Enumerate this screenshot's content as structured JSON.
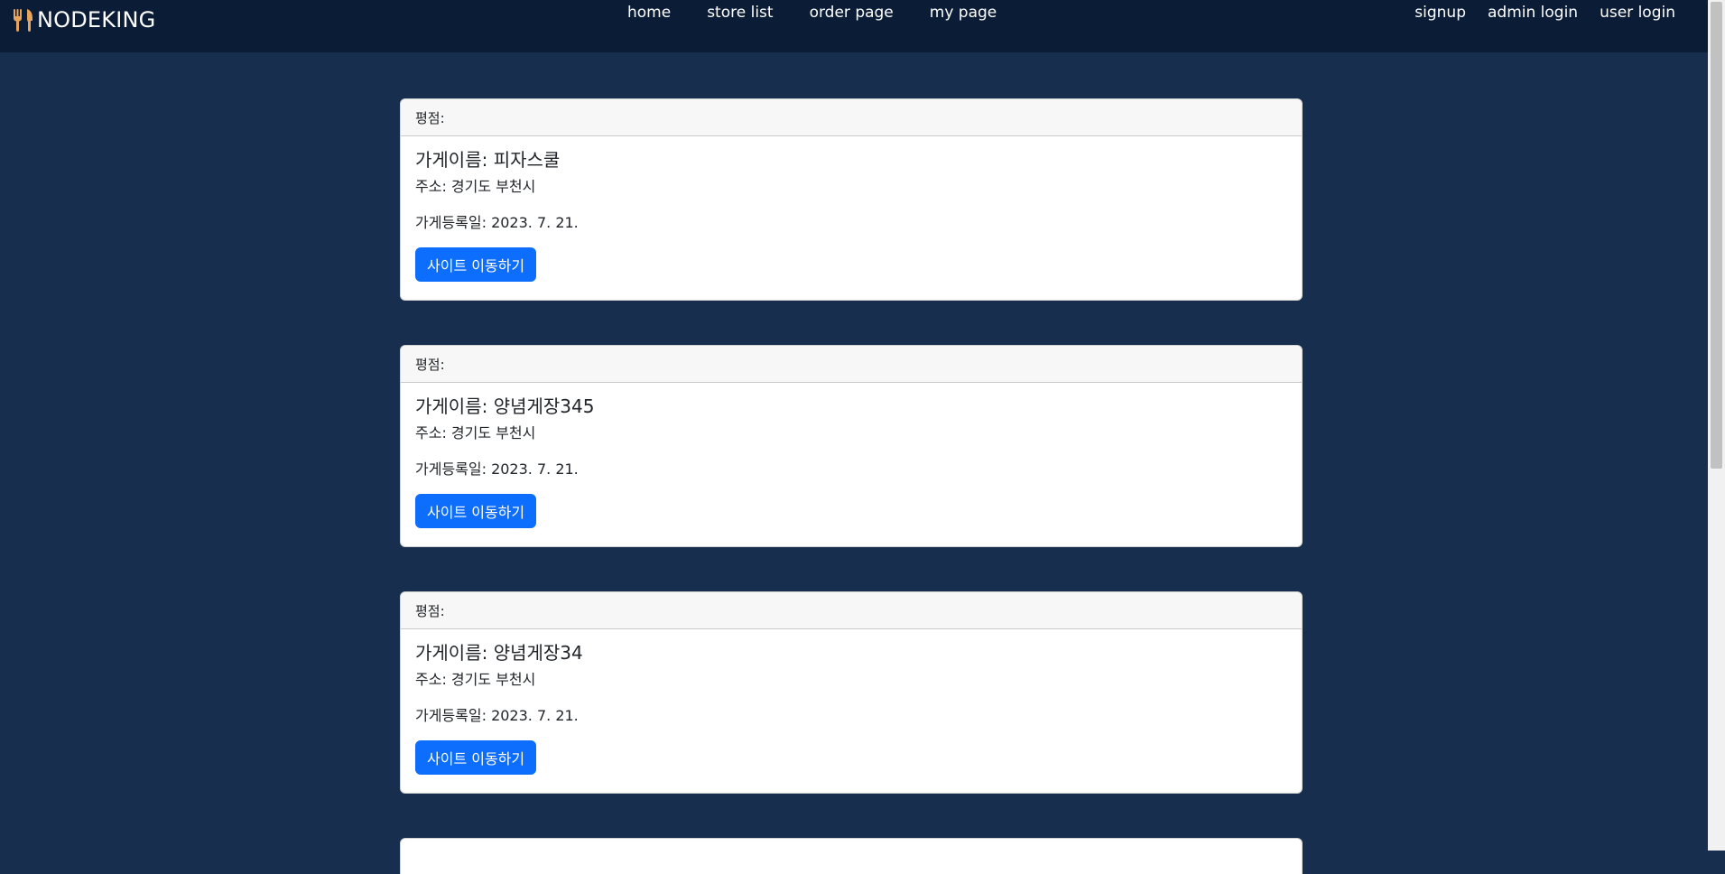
{
  "brand": {
    "name": "NODEKING",
    "icon": "fork-knife-icon",
    "icon_color": "#e8a45c"
  },
  "nav": {
    "center": [
      "home",
      "store list",
      "order page",
      "my page"
    ],
    "right": [
      "signup",
      "admin login",
      "user login"
    ]
  },
  "colors": {
    "page_bg": "#172e4e",
    "navbar_bg": "#0a1c36",
    "button_bg": "#0d6efd"
  },
  "stores": [
    {
      "rating_label": "평점:",
      "name": "가게이름: 피자스쿨",
      "address": "주소: 경기도 부천시",
      "registered": "가게등록일: 2023. 7. 21.",
      "button": "사이트 이동하기"
    },
    {
      "rating_label": "평점:",
      "name": "가게이름: 양념게장345",
      "address": "주소: 경기도 부천시",
      "registered": "가게등록일: 2023. 7. 21.",
      "button": "사이트 이동하기"
    },
    {
      "rating_label": "평점:",
      "name": "가게이름: 양념게장34",
      "address": "주소: 경기도 부천시",
      "registered": "가게등록일: 2023. 7. 21.",
      "button": "사이트 이동하기"
    }
  ]
}
